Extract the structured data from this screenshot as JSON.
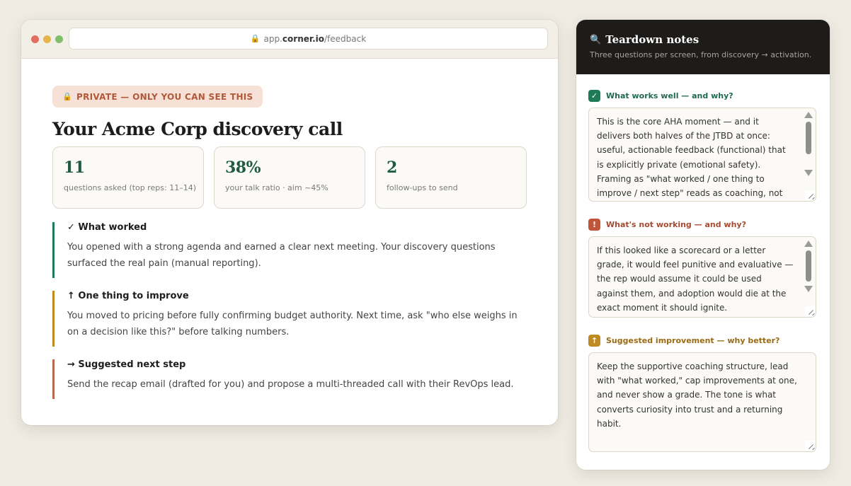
{
  "browser": {
    "url_prefix": "app.",
    "url_domain": "corner.io",
    "url_path": "/feedback",
    "lock_icon": "🔒"
  },
  "page": {
    "private_label": "PRIVATE — ONLY YOU CAN SEE THIS",
    "title": "Your Acme Corp discovery call",
    "stats": [
      {
        "value": "11",
        "label": "questions asked (top reps: 11–14)"
      },
      {
        "value": "38%",
        "label": "your talk ratio · aim ~45%"
      },
      {
        "value": "2",
        "label": "follow-ups to send"
      }
    ],
    "feedback": {
      "worked": {
        "heading": "✓ What worked",
        "body": "You opened with a strong agenda and earned a clear next meeting. Your discovery questions surfaced the real pain (manual reporting)."
      },
      "improve": {
        "heading": "↑ One thing to improve",
        "body": "You moved to pricing before fully confirming budget authority. Next time, ask \"who else weighs in on a decision like this?\" before talking numbers."
      },
      "next": {
        "heading": "→ Suggested next step",
        "body": "Send the recap email (drafted for you) and propose a multi-threaded call with their RevOps lead."
      }
    }
  },
  "panel": {
    "title": "Teardown notes",
    "subtitle": "Three questions per screen, from discovery → activation.",
    "questions": [
      {
        "badge": "✓",
        "label": "What works well — and why?",
        "text": "This is the core AHA moment — and it delivers both halves of the JTBD at once: useful, actionable feedback (functional) that is explicitly private (emotional safety). Framing as \"what worked / one thing to improve / next step\" reads as coaching, not judgement. The"
      },
      {
        "badge": "!",
        "label": "What's not working — and why?",
        "text": "If this looked like a scorecard or a letter grade, it would feel punitive and evaluative — the rep would assume it could be used against them, and adoption would die at the exact moment it should ignite."
      },
      {
        "badge": "↑",
        "label": "Suggested improvement — why better?",
        "text": "Keep the supportive coaching structure, lead with \"what worked,\" cap improvements at one, and never show a grade. The tone is what converts curiosity into trust and a returning habit."
      }
    ]
  },
  "colors": {
    "accent_green": "#1f7a5a",
    "accent_amber": "#c08a22",
    "accent_rust": "#b86a4c",
    "panel_dark": "#1e1c1a"
  }
}
